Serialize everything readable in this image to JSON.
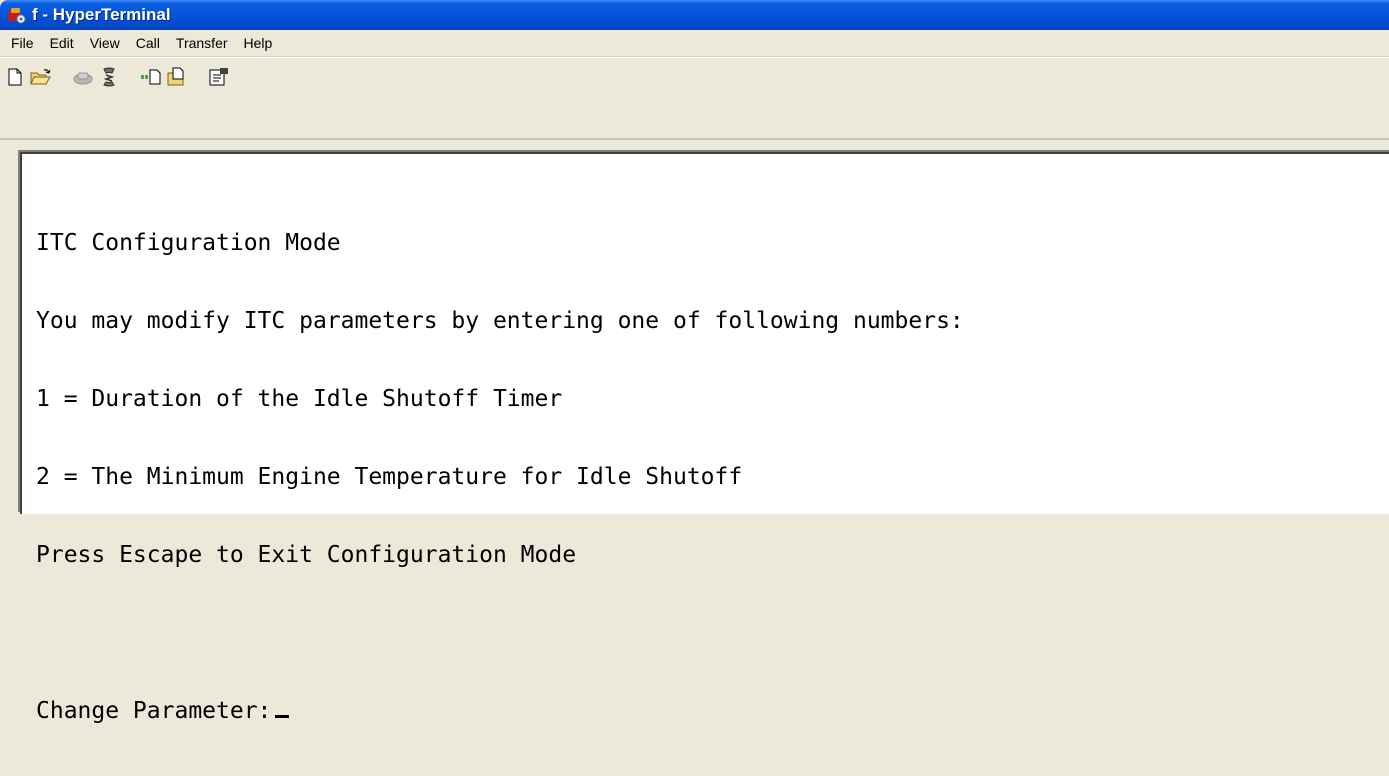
{
  "window": {
    "title": "f - HyperTerminal",
    "icon": "hyperterminal-icon"
  },
  "menu": [
    {
      "label": "File"
    },
    {
      "label": "Edit"
    },
    {
      "label": "View"
    },
    {
      "label": "Call"
    },
    {
      "label": "Transfer"
    },
    {
      "label": "Help"
    }
  ],
  "toolbar": {
    "buttons": [
      {
        "icon": "new-file-icon"
      },
      {
        "icon": "open-folder-icon"
      },
      {
        "icon": "call-icon"
      },
      {
        "icon": "disconnect-icon"
      },
      {
        "icon": "send-icon"
      },
      {
        "icon": "receive-icon"
      },
      {
        "icon": "properties-icon"
      }
    ]
  },
  "terminal": {
    "lines": [
      "ITC Configuration Mode",
      "You may modify ITC parameters by entering one of following numbers:",
      "1 = Duration of the Idle Shutoff Timer",
      "2 = The Minimum Engine Temperature for Idle Shutoff",
      "Press Escape to Exit Configuration Mode",
      "",
      "Change Parameter:"
    ]
  }
}
